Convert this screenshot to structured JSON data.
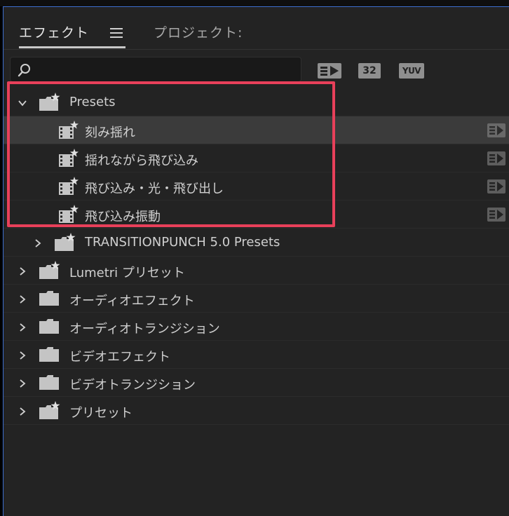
{
  "panel": {
    "tabs": [
      {
        "label": "エフェクト",
        "active": true
      },
      {
        "label": "プロジェクト:",
        "active": false
      }
    ]
  },
  "search": {
    "value": "",
    "placeholder": ""
  },
  "toolbar": {
    "accelerated_icon": "accelerated-effects-icon",
    "bit32_label": "32",
    "yuv_label": "YUV"
  },
  "tree": [
    {
      "label": "Presets",
      "indent": 0,
      "expanded": true,
      "icon": "preset-folder-icon"
    },
    {
      "label": "刻み揺れ",
      "indent": 1,
      "icon": "preset-clip-icon",
      "selected": true,
      "accelerated": true
    },
    {
      "label": "揺れながら飛び込み",
      "indent": 1,
      "icon": "preset-clip-icon",
      "accelerated": true
    },
    {
      "label": "飛び込み・光・飛び出し",
      "indent": 1,
      "icon": "preset-clip-icon",
      "accelerated": true
    },
    {
      "label": "飛び込み振動",
      "indent": 1,
      "icon": "preset-clip-icon",
      "accelerated": true
    },
    {
      "label": "TRANSITIONPUNCH 5.0 Presets",
      "indent": 1,
      "expanded": false,
      "icon": "preset-folder-icon"
    },
    {
      "label": "Lumetri プリセット",
      "indent": 0,
      "expanded": false,
      "icon": "preset-folder-icon"
    },
    {
      "label": "オーディオエフェクト",
      "indent": 0,
      "expanded": false,
      "icon": "folder-icon"
    },
    {
      "label": "オーディオトランジション",
      "indent": 0,
      "expanded": false,
      "icon": "folder-icon"
    },
    {
      "label": "ビデオエフェクト",
      "indent": 0,
      "expanded": false,
      "icon": "folder-icon"
    },
    {
      "label": "ビデオトランジション",
      "indent": 0,
      "expanded": false,
      "icon": "folder-icon"
    },
    {
      "label": "プリセット",
      "indent": 0,
      "expanded": false,
      "icon": "preset-folder-icon"
    }
  ],
  "colors": {
    "panel_bg": "#232323",
    "selected_row": "#3b3b3b",
    "highlight_border": "#e8405a",
    "text": "#cfcfcf",
    "focus_border": "#3d6fd0"
  }
}
